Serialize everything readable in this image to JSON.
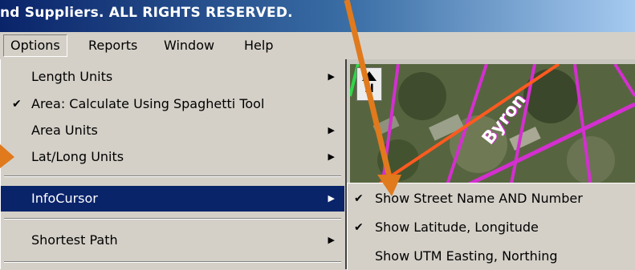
{
  "window": {
    "title": "nd Suppliers. ALL RIGHTS RESERVED."
  },
  "menubar": {
    "items": [
      {
        "label": "Options"
      },
      {
        "label": "Reports"
      },
      {
        "label": "Window"
      },
      {
        "label": "Help"
      }
    ]
  },
  "options_menu": {
    "items": [
      {
        "label": "Length Units",
        "checked": false,
        "submenu": true
      },
      {
        "label": "Area: Calculate Using Spaghetti Tool",
        "checked": true,
        "submenu": false
      },
      {
        "label": "Area Units",
        "checked": false,
        "submenu": true
      },
      {
        "label": "Lat/Long Units",
        "checked": false,
        "submenu": true
      },
      {
        "label": "InfoCursor",
        "checked": false,
        "submenu": true,
        "highlighted": true
      },
      {
        "label": "Shortest Path",
        "checked": false,
        "submenu": true
      }
    ]
  },
  "infocursor_submenu": {
    "items": [
      {
        "label": "Show Street Name AND Number",
        "checked": true
      },
      {
        "label": "Show Latitude, Longitude",
        "checked": true
      },
      {
        "label": "Show UTM Easting, Northing",
        "checked": false
      }
    ]
  },
  "map": {
    "north_label": "N",
    "street_labels": [
      "Byron"
    ]
  },
  "colors": {
    "menu_highlight": "#0a246a",
    "title_bar": "#0a246a",
    "annotation_arrow": "#e07a1c",
    "road_pink": "#d42fd0",
    "road_orange": "#ff5a1f"
  },
  "icons": {
    "checkmark": "check-icon",
    "submenu_arrow": "submenu-arrow-icon",
    "north_arrow": "north-arrow-icon"
  }
}
